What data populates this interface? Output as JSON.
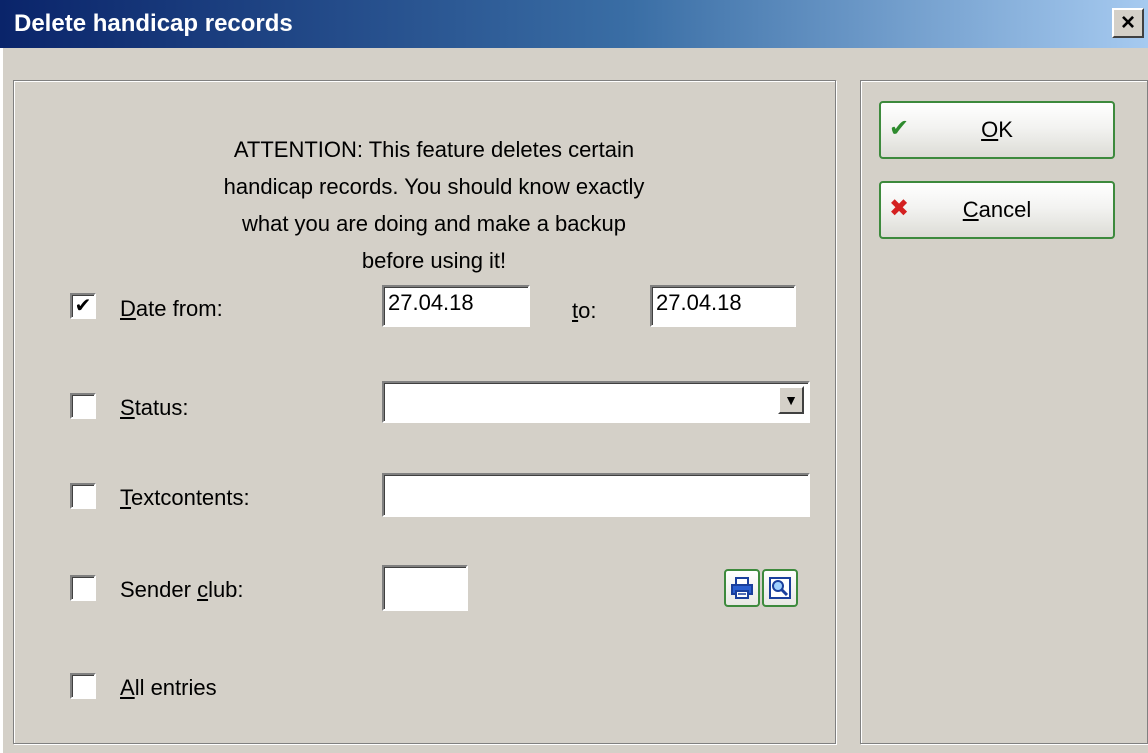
{
  "window": {
    "title": "Delete handicap records",
    "close_label": "×"
  },
  "attention": {
    "lines": [
      "ATTENTION: This feature deletes certain",
      "handicap records. You should know exactly",
      "what you are doing and make a backup",
      "before using it!"
    ]
  },
  "filters": {
    "date_from": {
      "checked": true,
      "label_pre": "",
      "label_u": "D",
      "label_post": "ate from:",
      "value": "27.04.18"
    },
    "date_to": {
      "label_u": "t",
      "label_post": "o:",
      "value": "27.04.18"
    },
    "status": {
      "checked": false,
      "label_u": "S",
      "label_post": "tatus:",
      "value": ""
    },
    "textcontents": {
      "checked": false,
      "label_u": "T",
      "label_post": "extcontents:",
      "value": ""
    },
    "sender_club": {
      "checked": false,
      "label_pre": "Sender ",
      "label_u": "c",
      "label_post": "lub:",
      "value": ""
    },
    "all_entries": {
      "checked": false,
      "label_u": "A",
      "label_post": "ll entries"
    }
  },
  "buttons": {
    "ok_u": "O",
    "ok_post": "K",
    "cancel_u": "C",
    "cancel_post": "ancel"
  },
  "colors": {
    "ok_check": "#2e8b2e",
    "cancel_x": "#d42020",
    "button_border": "#3d8a3d"
  },
  "icons": {
    "ok": "check-icon",
    "cancel": "x-icon",
    "print": "print-icon",
    "search": "search-icon"
  }
}
